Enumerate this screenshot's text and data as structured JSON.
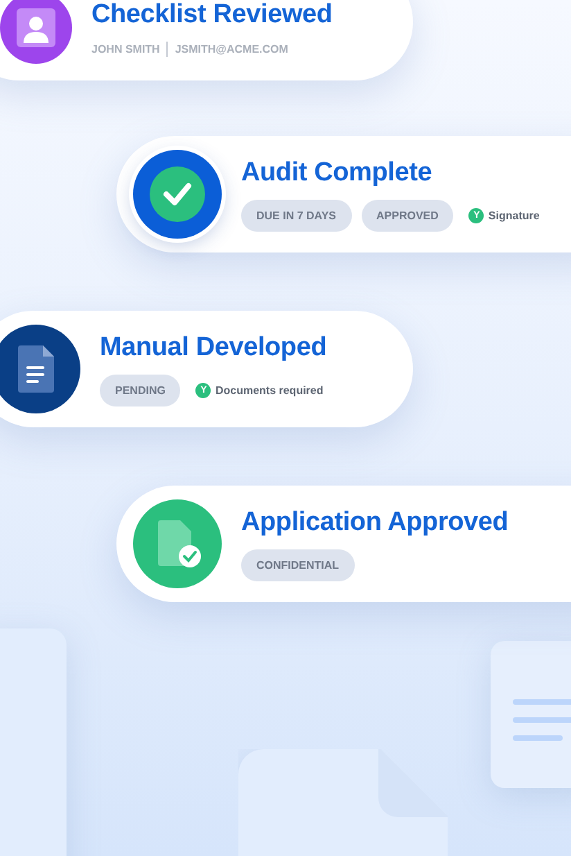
{
  "cards": [
    {
      "kind": "person",
      "title": "Checklist Reviewed",
      "meta": [
        "JOHN SMITH",
        "JSMITH@ACME.COM"
      ]
    },
    {
      "kind": "check",
      "title": "Audit Complete",
      "tags": [
        "DUE IN 7 DAYS",
        "APPROVED"
      ],
      "note": {
        "badge": "Y",
        "text": "Signature"
      }
    },
    {
      "kind": "document",
      "title": "Manual Developed",
      "tags": [
        "PENDING"
      ],
      "note": {
        "badge": "Y",
        "text": "Documents required"
      }
    },
    {
      "kind": "document-check",
      "title": "Application Approved",
      "tags": [
        "CONFIDENTIAL"
      ]
    }
  ]
}
